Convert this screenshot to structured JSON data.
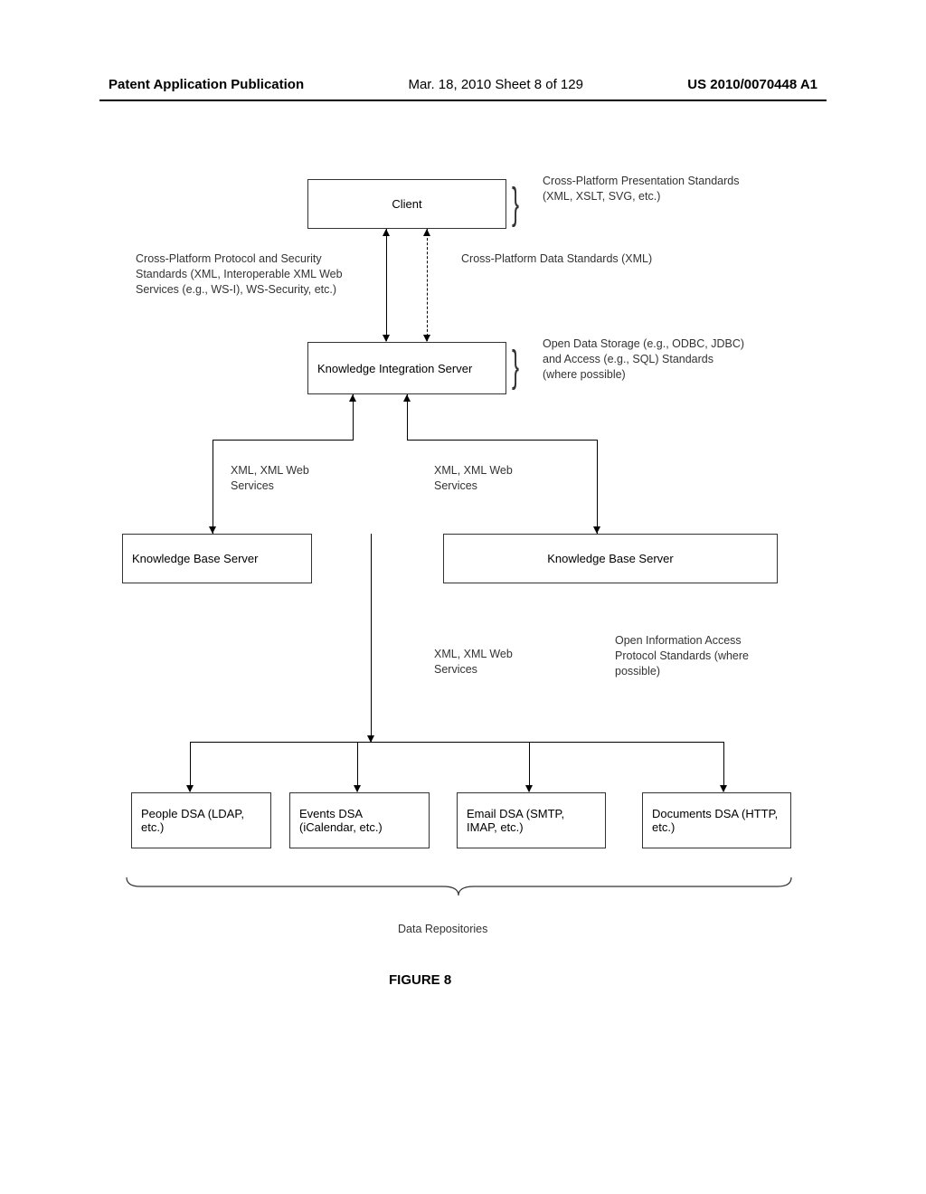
{
  "header": {
    "left": "Patent Application Publication",
    "mid": "Mar. 18, 2010  Sheet 8 of 129",
    "right": "US 2010/0070448 A1"
  },
  "boxes": {
    "client": "Client",
    "kis": "Knowledge Integration Server",
    "kbs_left": "Knowledge Base Server",
    "kbs_right": "Knowledge Base Server",
    "people_dsa": "People DSA (LDAP, etc.)",
    "events_dsa": "Events DSA (iCalendar, etc.)",
    "email_dsa": "Email DSA (SMTP, IMAP, etc.)",
    "docs_dsa": "Documents DSA (HTTP, etc.)"
  },
  "labels": {
    "client_right": "Cross-Platform Presentation Standards (XML, XSLT, SVG, etc.)",
    "protocol_left": "Cross-Platform Protocol and Security Standards (XML, Interoperable XML Web Services (e.g., WS-I), WS-Security, etc.)",
    "data_right": "Cross-Platform Data Standards (XML)",
    "kis_right": "Open Data Storage (e.g., ODBC, JDBC) and Access (e.g., SQL) Standards (where possible)",
    "xml_ws_left": "XML, XML Web Services",
    "xml_ws_right": "XML, XML Web Services",
    "xml_ws_bottom": "XML, XML Web Services",
    "open_info": "Open Information Access Protocol Standards (where possible)",
    "data_repos": "Data Repositories"
  },
  "figure": {
    "title": "FIGURE 8"
  }
}
